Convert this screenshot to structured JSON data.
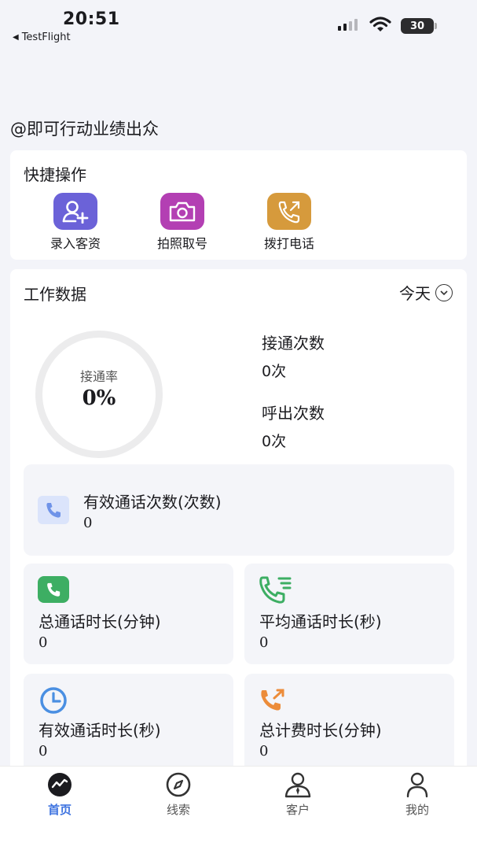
{
  "status_bar": {
    "time": "20:51",
    "back_app": "TestFlight",
    "battery": "30"
  },
  "user_tag": "@即可行动业绩出众",
  "quick_actions": {
    "title": "快捷操作",
    "items": [
      {
        "label": "录入客资",
        "icon": "add-user-icon",
        "color": "#6b62d8"
      },
      {
        "label": "拍照取号",
        "icon": "camera-icon",
        "color": "#b33fb3"
      },
      {
        "label": "拨打电话",
        "icon": "phone-outgoing-icon",
        "color": "#d69a3c"
      }
    ]
  },
  "work_data": {
    "title": "工作数据",
    "period": "今天",
    "connect_rate_label": "接通率",
    "connect_rate_value": "0%",
    "connect_count": {
      "title": "接通次数",
      "value": "0次"
    },
    "outgoing_count": {
      "title": "呼出次数",
      "value": "0次"
    },
    "valid_call_count": {
      "title": "有效通话次数(次数)",
      "value": "0"
    },
    "total_duration": {
      "title": "总通话时长(分钟)",
      "value": "0"
    },
    "avg_duration": {
      "title": "平均通话时长(秒)",
      "value": "0"
    },
    "valid_duration": {
      "title": "有效通话时长(秒)",
      "value": "0"
    },
    "billing_duration": {
      "title": "总计费时长(分钟)",
      "value": "0"
    }
  },
  "tabs": [
    {
      "label": "首页",
      "icon": "trend-icon",
      "active": true
    },
    {
      "label": "线索",
      "icon": "compass-icon",
      "active": false
    },
    {
      "label": "客户",
      "icon": "customer-icon",
      "active": false
    },
    {
      "label": "我的",
      "icon": "profile-icon",
      "active": false
    }
  ],
  "colors": {
    "accent": "#3f74e0",
    "background": "#f3f4f9"
  }
}
